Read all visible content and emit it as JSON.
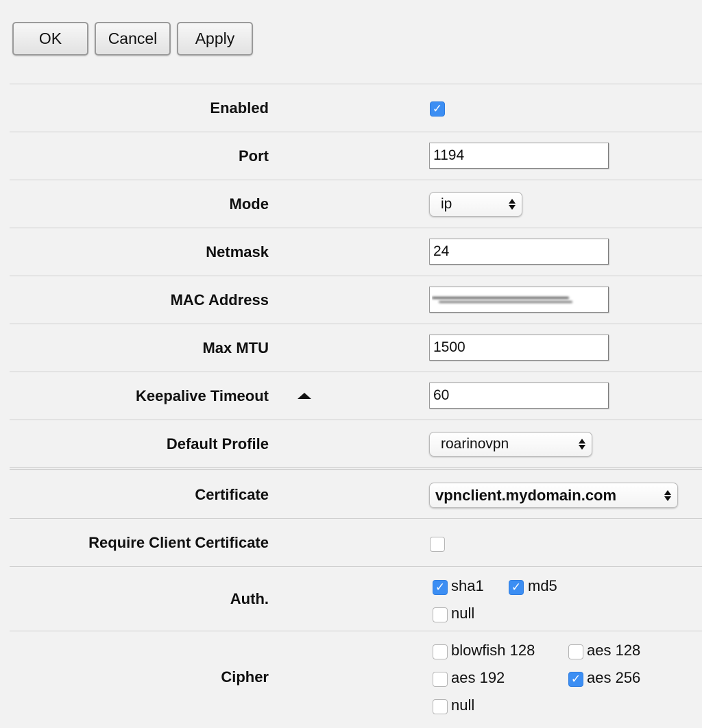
{
  "toolbar": {
    "ok_label": "OK",
    "cancel_label": "Cancel",
    "apply_label": "Apply"
  },
  "fields": {
    "enabled": {
      "label": "Enabled",
      "checked": true
    },
    "port": {
      "label": "Port",
      "value": "1194"
    },
    "mode": {
      "label": "Mode",
      "value": "ip"
    },
    "netmask": {
      "label": "Netmask",
      "value": "24"
    },
    "mac_address": {
      "label": "MAC Address",
      "value": ""
    },
    "max_mtu": {
      "label": "Max MTU",
      "value": "1500"
    },
    "keepalive_timeout": {
      "label": "Keepalive Timeout",
      "value": "60"
    },
    "default_profile": {
      "label": "Default Profile",
      "value": "roarinovpn"
    },
    "certificate": {
      "label": "Certificate",
      "value": "vpnclient.mydomain.com"
    },
    "require_client_certificate": {
      "label": "Require Client Certificate",
      "checked": false
    },
    "auth": {
      "label": "Auth.",
      "options": [
        {
          "label": "sha1",
          "checked": true
        },
        {
          "label": "md5",
          "checked": true
        },
        {
          "label": "null",
          "checked": false
        }
      ]
    },
    "cipher": {
      "label": "Cipher",
      "options": [
        {
          "label": "blowfish 128",
          "checked": false
        },
        {
          "label": "aes 128",
          "checked": false
        },
        {
          "label": "aes 192",
          "checked": false
        },
        {
          "label": "aes 256",
          "checked": true
        },
        {
          "label": "null",
          "checked": false
        }
      ]
    }
  },
  "icons": {
    "checkmark": "check-icon",
    "collapse": "triangle-up-icon",
    "select_arrows": "updown-arrows-icon"
  },
  "colors": {
    "background": "#f2f2f2",
    "checkbox_checked": "#3c8ef3",
    "divider": "#cfcfcf"
  }
}
